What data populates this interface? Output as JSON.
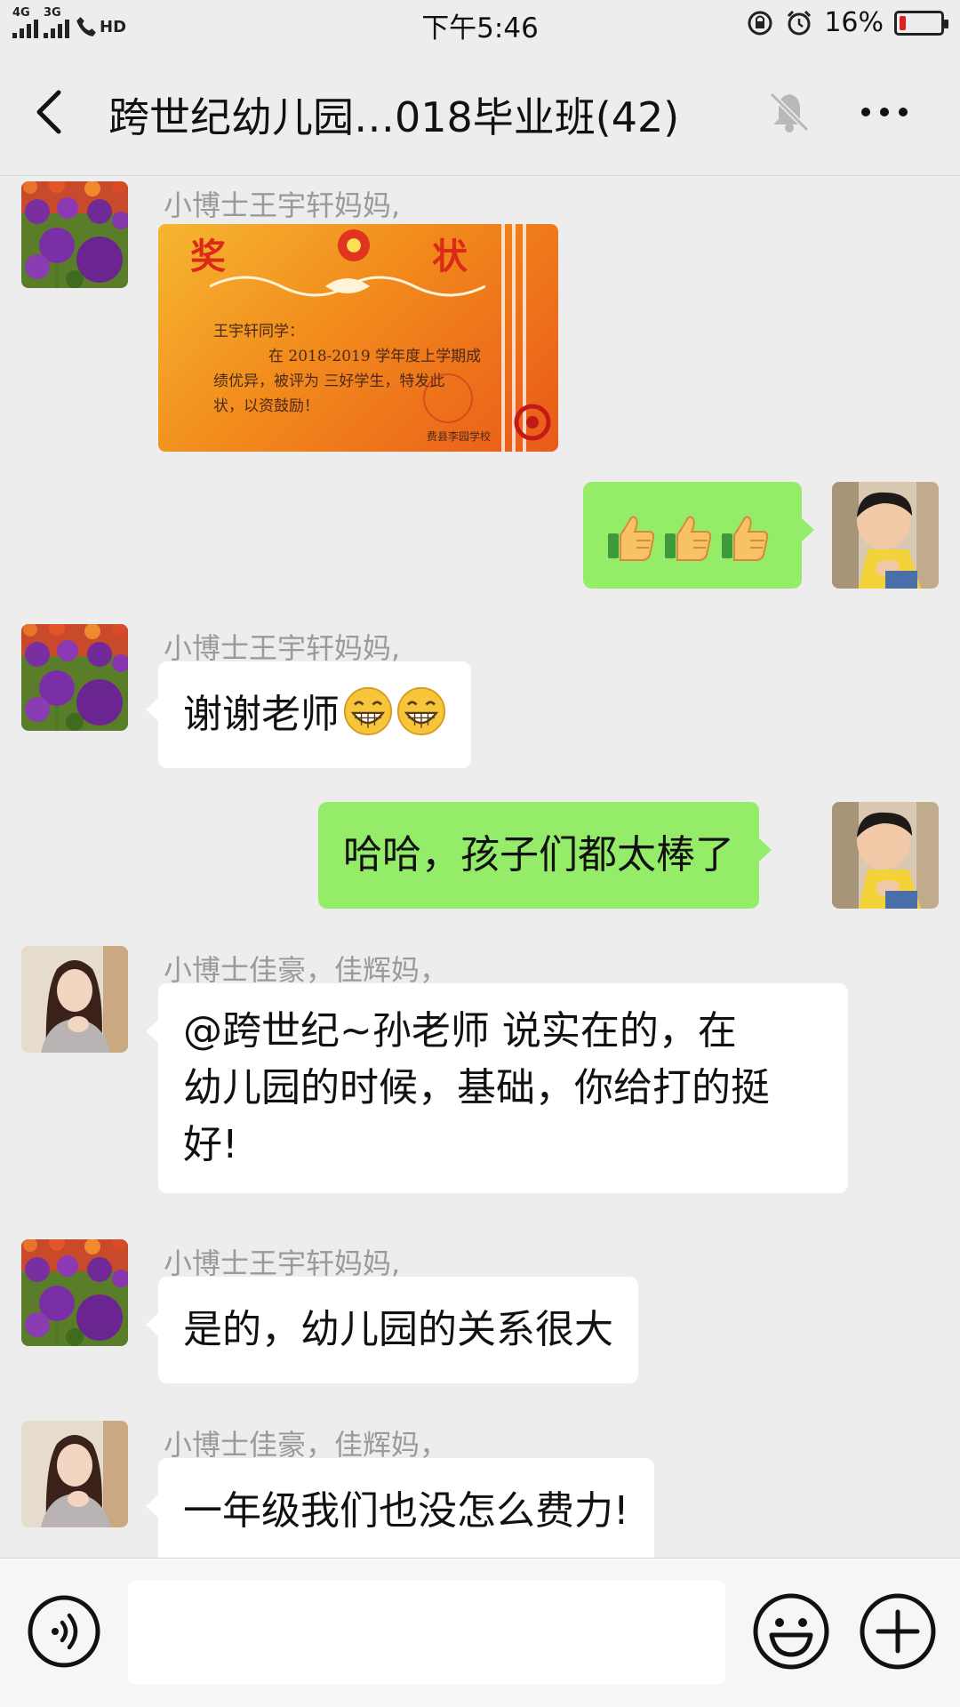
{
  "status_bar": {
    "network_1": "4G",
    "network_2": "3G",
    "hd_label": "HD",
    "time": "下午5:46",
    "battery_percent_text": "16%",
    "battery_level": 0.16,
    "battery_color": "#e02020"
  },
  "nav": {
    "title": "跨世纪幼儿园…018毕业班(42)",
    "back_icon": "chevron-left-icon",
    "mute_icon": "bell-off-icon",
    "more_icon": "more-dots-icon"
  },
  "colors": {
    "background": "#ededed",
    "outgoing_bubble": "#95ec69",
    "incoming_bubble": "#ffffff",
    "sender_name": "#9a9a9a"
  },
  "messages": [
    {
      "direction": "incoming",
      "sender": "小博士王宇轩妈妈,",
      "type": "image",
      "image": {
        "heading_left": "奖",
        "heading_right": "状",
        "line1": "王宇轩同学：",
        "line2": "在 2018-2019 学年度上学期成",
        "line3": "绩优异，被评为 三好学生，特发此",
        "line4": "状，以资鼓励！",
        "issuer": "费县李园学校"
      }
    },
    {
      "direction": "outgoing",
      "type": "emoji",
      "emoji": [
        "thumbs-up-icon",
        "thumbs-up-icon",
        "thumbs-up-icon"
      ]
    },
    {
      "direction": "incoming",
      "sender": "小博士王宇轩妈妈,",
      "type": "text",
      "text": "谢谢老师",
      "emoji": [
        "grinning-face-icon",
        "grinning-face-icon"
      ]
    },
    {
      "direction": "outgoing",
      "type": "text",
      "text": "哈哈，孩子们都太棒了"
    },
    {
      "direction": "incoming",
      "sender": "小博士佳豪，佳辉妈，",
      "type": "text",
      "lines": [
        "@跨世纪~孙老师  说实在的，在",
        "幼儿园的时候，基础，你给打的挺",
        "好!"
      ]
    },
    {
      "direction": "incoming",
      "sender": "小博士王宇轩妈妈,",
      "type": "text",
      "text": "是的，幼儿园的关系很大"
    },
    {
      "direction": "incoming",
      "sender": "小博士佳豪，佳辉妈，",
      "type": "text",
      "text": "一年级我们也没怎么费力!"
    }
  ],
  "input_bar": {
    "voice_icon": "voice-icon",
    "input_value": "",
    "emoji_icon": "emoji-smile-icon",
    "plus_icon": "plus-circle-icon"
  }
}
